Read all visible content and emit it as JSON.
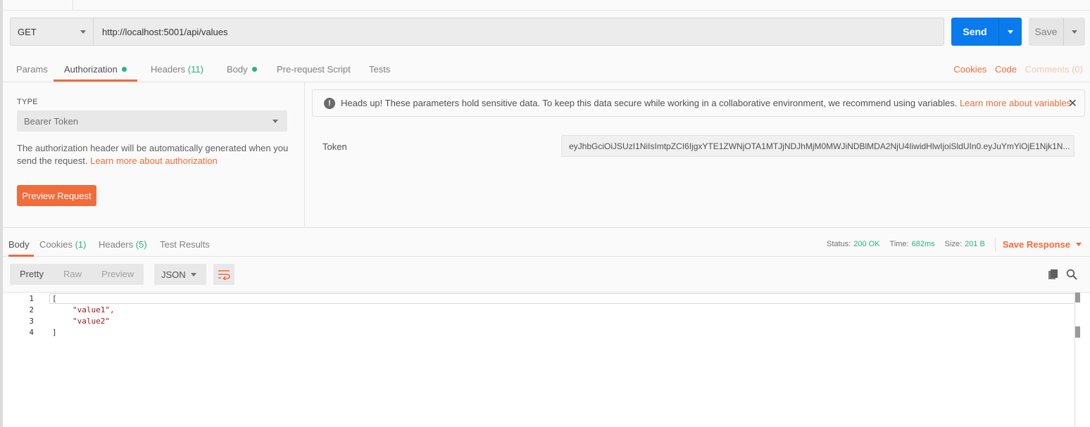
{
  "request": {
    "method": "GET",
    "url": "http://localhost:5001/api/values",
    "send_label": "Send",
    "save_label": "Save"
  },
  "request_tabs": [
    {
      "label": "Params"
    },
    {
      "label": "Authorization",
      "indicator": "green-dot"
    },
    {
      "label": "Headers",
      "count": "(11)"
    },
    {
      "label": "Body",
      "indicator": "green-dot"
    },
    {
      "label": "Pre-request Script"
    },
    {
      "label": "Tests"
    }
  ],
  "request_links": {
    "cookies": "Cookies",
    "code": "Code",
    "comments": "Comments (0)"
  },
  "auth": {
    "type_label": "TYPE",
    "type_value": "Bearer Token",
    "description": "The authorization header will be automatically generated when you send the request.",
    "description_link": "Learn more about authorization",
    "preview_button": "Preview Request",
    "warning_text": "Heads up! These parameters hold sensitive data. To keep this data secure while working in a collaborative environment, we recommend using variables.",
    "warning_link": "Learn more about variables",
    "token_label": "Token",
    "token_value": "eyJhbGciOiJSUzI1NiIsImtpZCI6IjgxYTE1ZWNjOTA1MTJjNDJhMjM0MWJiNDBlMDA2NjU4IiwidHlwIjoiSldUIn0.eyJuYmYiOjE1Njk1N..."
  },
  "response": {
    "tabs": [
      {
        "label": "Body"
      },
      {
        "label": "Cookies",
        "count": "(1)"
      },
      {
        "label": "Headers",
        "count": "(5)"
      },
      {
        "label": "Test Results"
      }
    ],
    "status_label": "Status:",
    "status_value": "200 OK",
    "time_label": "Time:",
    "time_value": "682ms",
    "size_label": "Size:",
    "size_value": "201 B",
    "save_response": "Save Response",
    "view_modes": [
      "Pretty",
      "Raw",
      "Preview"
    ],
    "format": "JSON",
    "line_numbers": [
      "1",
      "2",
      "3",
      "4"
    ],
    "code_lines": [
      "[",
      "\"value1\",",
      "\"value2\"",
      "]"
    ]
  },
  "colors": {
    "accent": "#f26b3a",
    "send_blue": "#097bed",
    "status_green": "#26b47f"
  }
}
